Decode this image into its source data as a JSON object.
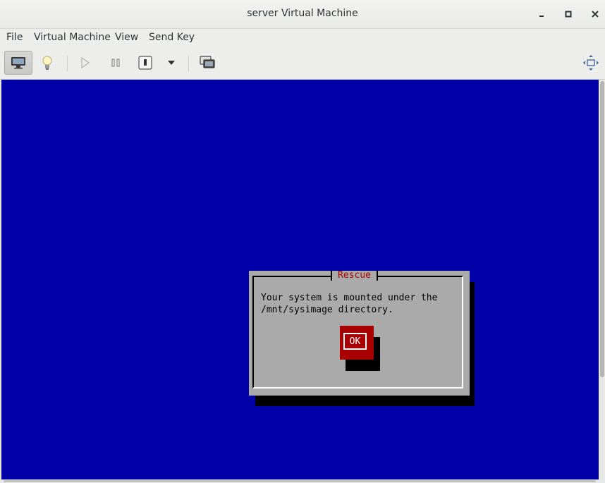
{
  "window": {
    "title": "server Virtual Machine",
    "controls": {
      "minimize": "_",
      "maximize": "□",
      "close": "✕"
    }
  },
  "menubar": {
    "items": [
      {
        "label": "File"
      },
      {
        "label": "Virtual Machine"
      },
      {
        "label": "View"
      },
      {
        "label": "Send Key"
      }
    ]
  },
  "toolbar": {
    "buttons": [
      {
        "icon": "monitor-icon",
        "active": true
      },
      {
        "icon": "lightbulb-icon"
      },
      {
        "icon": "play-icon"
      },
      {
        "icon": "pause-icon"
      },
      {
        "icon": "power-icon"
      },
      {
        "icon": "chevron-down-icon"
      },
      {
        "icon": "snapshots-icon"
      },
      {
        "icon": "fullscreen-icon"
      }
    ]
  },
  "console": {
    "background": "#0000a8",
    "dialog": {
      "title": "Rescue",
      "message": "Your system is mounted under the\n/mnt/sysimage directory.",
      "ok_label": "OK"
    }
  },
  "colors": {
    "accent": "#a80000",
    "dialog_bg": "#aaaaaa",
    "console_bg": "#0000a8"
  }
}
